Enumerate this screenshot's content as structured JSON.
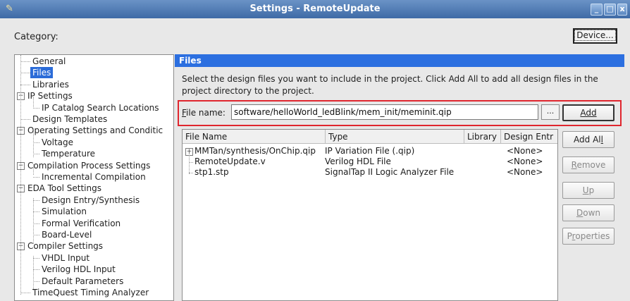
{
  "window": {
    "title": "Settings - RemoteUpdate",
    "controls": {
      "minimize": "_",
      "maximize": "□",
      "close": "x"
    }
  },
  "category_label": "Category:",
  "device_button": "Device...",
  "tree": [
    {
      "label": "General",
      "level": 1,
      "selected": false
    },
    {
      "label": "Files",
      "level": 1,
      "selected": true
    },
    {
      "label": "Libraries",
      "level": 1,
      "selected": false
    },
    {
      "label": "IP Settings",
      "level": 0,
      "selected": false,
      "expanded": true
    },
    {
      "label": "IP Catalog Search Locations",
      "level": 2,
      "selected": false
    },
    {
      "label": "Design Templates",
      "level": 1,
      "selected": false
    },
    {
      "label": "Operating Settings and Conditic",
      "level": 0,
      "selected": false,
      "expanded": true
    },
    {
      "label": "Voltage",
      "level": 2,
      "selected": false
    },
    {
      "label": "Temperature",
      "level": 2,
      "selected": false
    },
    {
      "label": "Compilation Process Settings",
      "level": 0,
      "selected": false,
      "expanded": true
    },
    {
      "label": "Incremental Compilation",
      "level": 2,
      "selected": false
    },
    {
      "label": "EDA Tool Settings",
      "level": 0,
      "selected": false,
      "expanded": true
    },
    {
      "label": "Design Entry/Synthesis",
      "level": 2,
      "selected": false
    },
    {
      "label": "Simulation",
      "level": 2,
      "selected": false
    },
    {
      "label": "Formal Verification",
      "level": 2,
      "selected": false
    },
    {
      "label": "Board-Level",
      "level": 2,
      "selected": false
    },
    {
      "label": "Compiler Settings",
      "level": 0,
      "selected": false,
      "expanded": true
    },
    {
      "label": "VHDL Input",
      "level": 2,
      "selected": false
    },
    {
      "label": "Verilog HDL Input",
      "level": 2,
      "selected": false
    },
    {
      "label": "Default Parameters",
      "level": 2,
      "selected": false
    },
    {
      "label": "TimeQuest Timing Analyzer",
      "level": 1,
      "selected": false
    }
  ],
  "panel": {
    "title": "Files",
    "description": "Select the design files you want to include in the project. Click Add All to add all design files in the project directory to the project.",
    "file_name_label": "File name:",
    "file_name_value": "software/helloWorld_ledBlink/mem_init/meminit.qip",
    "browse_label": "...",
    "buttons": {
      "add": "Add",
      "add_all": "Add All",
      "remove": "Remove",
      "up": "Up",
      "down": "Down",
      "properties": "Properties"
    },
    "table": {
      "columns": [
        "File Name",
        "Type",
        "Library",
        "Design Entr"
      ],
      "rows": [
        {
          "file": "MMTan/synthesis/OnChip.qip",
          "type": "IP Variation File (.qip)",
          "library": "",
          "design_entry": "<None>",
          "expandable": true
        },
        {
          "file": "RemoteUpdate.v",
          "type": "Verilog HDL File",
          "library": "",
          "design_entry": "<None>",
          "expandable": false
        },
        {
          "file": "stp1.stp",
          "type": "SignalTap II Logic Analyzer File",
          "library": "",
          "design_entry": "<None>",
          "expandable": false
        }
      ]
    }
  },
  "colors": {
    "titlebar": "#4a76b2",
    "panel_header": "#2c6fe0",
    "selection": "#2b6cd8",
    "highlight_border": "#e0262e"
  }
}
